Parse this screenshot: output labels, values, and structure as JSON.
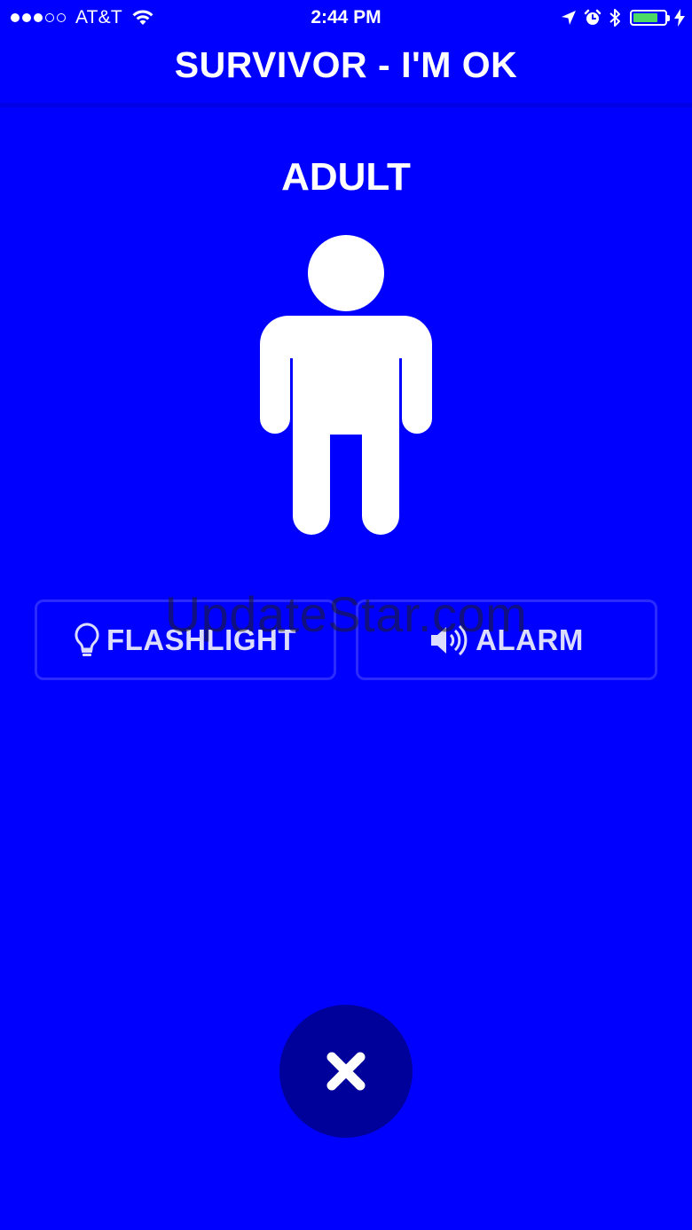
{
  "status_bar": {
    "carrier": "AT&T",
    "time": "2:44 PM",
    "signal_bars_filled": 3,
    "signal_bars_total": 5,
    "battery_level": 0.8,
    "battery_color": "#4cd964",
    "icons": [
      "wifi-icon",
      "location-arrow-icon",
      "alarm-clock-icon",
      "bluetooth-icon",
      "battery-icon",
      "charging-bolt-icon"
    ]
  },
  "header": {
    "title": "SURVIVOR - I'M OK"
  },
  "main": {
    "person_label": "ADULT",
    "person_icon": "adult-person-icon",
    "buttons": [
      {
        "label": "FLASHLIGHT",
        "icon": "lightbulb-icon"
      },
      {
        "label": "ALARM",
        "icon": "speaker-icon"
      }
    ],
    "watermark": "UpdateStar.com"
  },
  "close_button": {
    "icon": "close-icon"
  },
  "colors": {
    "background": "#0000ff",
    "close_button": "#00009a",
    "button_border": "#2b2bff",
    "text": "#ffffff"
  }
}
